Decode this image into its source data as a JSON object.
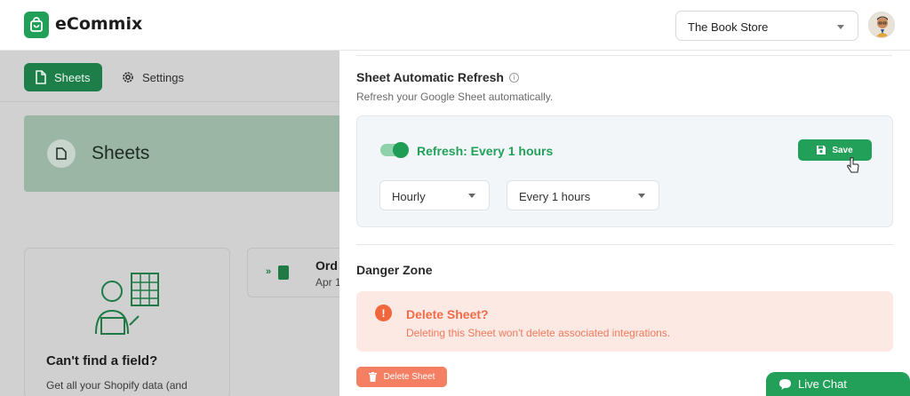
{
  "header": {
    "brand": "eCommix",
    "store_select": "The Book Store"
  },
  "left": {
    "tabs": [
      {
        "label": "Sheets",
        "active": true
      },
      {
        "label": "Settings",
        "active": false
      }
    ],
    "banner_title": "Sheets",
    "card_title": "Can't find a field?",
    "card_sub": "Get all your Shopify data (and",
    "sheet_card": {
      "title": "Ord",
      "date": "Apr 1"
    }
  },
  "drawer": {
    "refresh": {
      "title": "Sheet Automatic Refresh",
      "subtitle": "Refresh your Google Sheet automatically.",
      "toggle_on": true,
      "status": "Refresh: Every 1 hours",
      "save_label": "Save",
      "frequency": "Hourly",
      "interval": "Every 1 hours"
    },
    "danger": {
      "title": "Danger Zone",
      "heading": "Delete Sheet?",
      "description": "Deleting this Sheet won't delete associated integrations.",
      "button": "Delete Sheet"
    }
  },
  "live_chat": "Live Chat",
  "colors": {
    "brand_green": "#22a05a",
    "danger_orange": "#f0673d",
    "danger_bg": "#fde9e4"
  }
}
